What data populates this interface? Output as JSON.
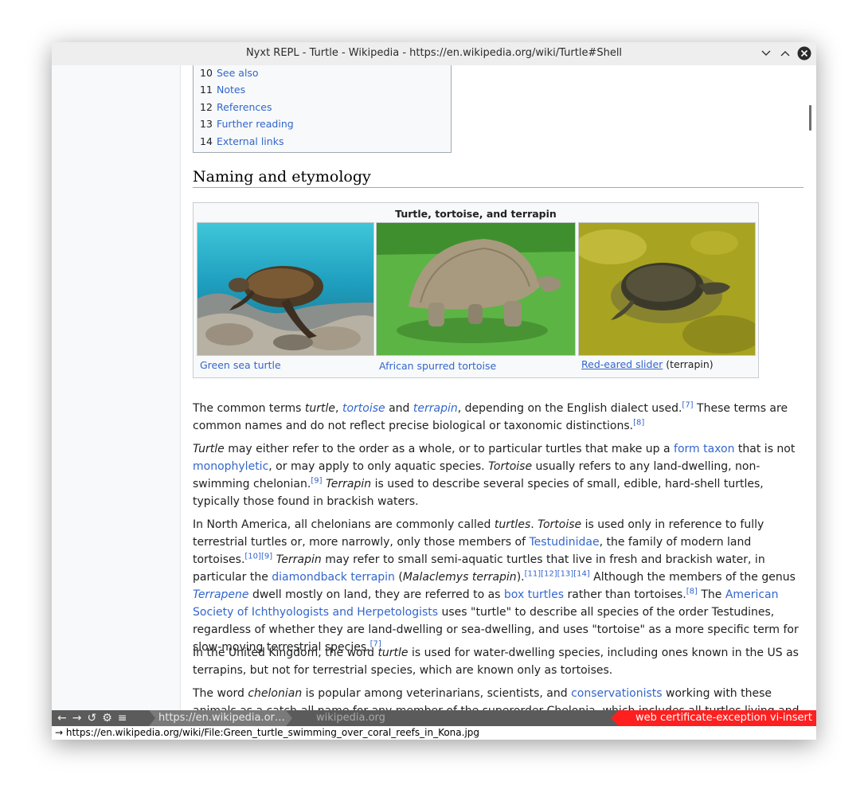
{
  "window": {
    "title": "Nyxt REPL - Turtle - Wikipedia - https://en.wikipedia.org/wiki/Turtle#Shell"
  },
  "toc": [
    {
      "num": "10",
      "label": "See also"
    },
    {
      "num": "11",
      "label": "Notes"
    },
    {
      "num": "12",
      "label": "References"
    },
    {
      "num": "13",
      "label": "Further reading"
    },
    {
      "num": "14",
      "label": "External links"
    }
  ],
  "section": {
    "heading": "Naming and etymology"
  },
  "gallery": {
    "title": "Turtle, tortoise, and terrapin",
    "captions": {
      "sea_turtle": "Green sea turtle",
      "tortoise": "African spurred tortoise",
      "slider_link": "Red-eared slider",
      "slider_suffix": "(terrapin)"
    }
  },
  "article": {
    "p1": {
      "a": "The common terms ",
      "b": "turtle",
      "c": ", ",
      "d": "tortoise",
      "e": " and ",
      "f": "terrapin",
      "g": ", depending on the English dialect used.",
      "ref1": "[7]",
      "h": " These terms are common names and do not reflect precise biological or taxonomic distinctions.",
      "ref2": "[8]"
    },
    "p2": {
      "a": "Turtle",
      "b": " may either refer to the order as a whole, or to particular turtles that make up a ",
      "link1": "form taxon",
      "c": " that is not ",
      "link2": "monophyletic",
      "d": ", or may apply to only aquatic species. ",
      "e": "Tortoise",
      "f": " usually refers to any land-dwelling, non-swimming chelonian.",
      "ref1": "[9]",
      "g": " ",
      "h": "Terrapin",
      "i": " is used to describe several species of small, edible, hard-shell turtles, typically those found in brackish waters."
    },
    "p3": {
      "a": "In North America, all chelonians are commonly called ",
      "b": "turtles",
      "c": ". ",
      "d": "Tortoise",
      "e": " is used only in reference to fully terrestrial turtles or, more narrowly, only those members of ",
      "link1": "Testudinidae",
      "f": ", the family of modern land tortoises.",
      "ref1": "[10]",
      "ref2": "[9]",
      "g": " ",
      "h": "Terrapin",
      "i": " may refer to small semi-aquatic turtles that live in fresh and brackish water, in particular the ",
      "link2": "diamondback terrapin",
      "j": " (",
      "k": "Malaclemys terrapin",
      "l": ").",
      "ref3": "[11]",
      "ref4": "[12]",
      "ref5": "[13]",
      "ref6": "[14]",
      "m": " Although the members of the genus ",
      "link3": "Terrapene",
      "n": " dwell mostly on land, they are referred to as ",
      "link4": "box turtles",
      "o": " rather than tortoises.",
      "ref7": "[8]",
      "p": " The ",
      "link5": "American Society of Ichthyologists and Herpetologists",
      "q": " uses \"turtle\" to describe all species of the order Testudines, regardless of whether they are land-dwelling or sea-dwelling, and uses \"tortoise\" as a more specific term for slow-moving terrestrial species.",
      "ref8": "[7]"
    },
    "p4": {
      "a": "In the United Kingdom, the word ",
      "b": "turtle",
      "c": " is used for water-dwelling species, including ones known in the US as terrapins, but not for terrestrial species, which are known only as tortoises."
    },
    "p5": {
      "a": "The word ",
      "b": "chelonian",
      "c": " is popular among veterinarians, scientists, and ",
      "link1": "conservationists",
      "d": " working with these animals as a catch-all name for any member of the superorder Chelonia, which includes all turtles living and extinct, as"
    }
  },
  "statusbar": {
    "nav": [
      "←",
      "→",
      "↺",
      "⚙",
      "≡"
    ],
    "url": "https://en.wikipedia.or…",
    "domain": "wikipedia.org",
    "modes": "web certificate-exception vi-insert"
  },
  "message": "→ https://en.wikipedia.org/wiki/File:Green_turtle_swimming_over_coral_reefs_in_Kona.jpg",
  "colors": {
    "link": "#3366cc",
    "mode_badge": "#ff1f1f",
    "statusbar": "#5b5b5b"
  }
}
